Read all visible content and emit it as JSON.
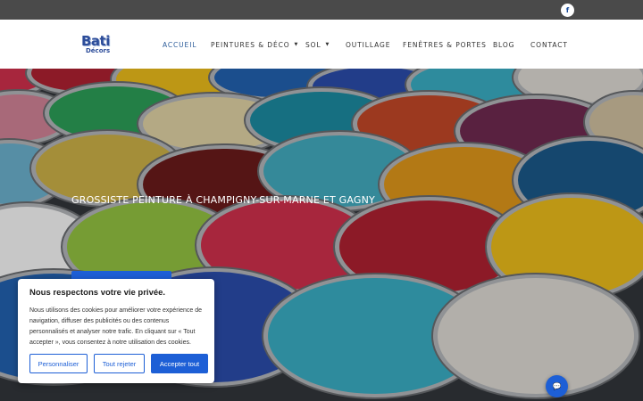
{
  "topbar": {
    "facebook_icon": "facebook-icon",
    "facebook_glyph": "f"
  },
  "brand": {
    "logo_line1": "Bati",
    "logo_line2": "Décors"
  },
  "nav": [
    {
      "label": "ACCUEIL",
      "active": true,
      "dropdown": false
    },
    {
      "label": "PEINTURES & DÉCO",
      "active": false,
      "dropdown": true
    },
    {
      "label": "SOL",
      "active": false,
      "dropdown": true
    },
    {
      "label": "OUTILLAGE",
      "active": false,
      "dropdown": false
    },
    {
      "label": "FENÊTRES & PORTES",
      "active": false,
      "dropdown": false
    },
    {
      "label": "BLOG",
      "active": false,
      "dropdown": false
    },
    {
      "label": "CONTACT",
      "active": false,
      "dropdown": false
    }
  ],
  "hero": {
    "title": "GROSSISTE PEINTURE À CHAMPIGNY-SUR-MARNE ET GAGNY",
    "paint_colors": [
      "#d6314f",
      "#b42232",
      "#f2c21b",
      "#2364b5",
      "#2c4fb0",
      "#3bb3c9",
      "#e4e1da",
      "#d8879b",
      "#2ea35a",
      "#e7d9a9",
      "#1d8fa6",
      "#c84a28",
      "#722b52",
      "#d6c6a4",
      "#6fb7d4",
      "#d3b64a",
      "#6e1c1c",
      "#45b0c4",
      "#e69b1c",
      "#1c5b8e",
      "#ffffff",
      "#98c843"
    ]
  },
  "cookie": {
    "title": "Nous respectons votre vie privée.",
    "text": "Nous utilisons des cookies pour améliorer votre expérience de navigation, diffuser des publicités ou des contenus personnalisés et analyser notre trafic. En cliquant sur « Tout accepter », vous consentez à notre utilisation des cookies.",
    "customize_label": "Personnaliser",
    "reject_label": "Tout rejeter",
    "accept_label": "Accepter tout"
  },
  "chat": {
    "icon": "chat-icon",
    "glyph": "💬"
  },
  "colors": {
    "accent": "#1d5fd6",
    "nav_active": "#2d5d9a",
    "topbar": "#4a4a4a"
  }
}
